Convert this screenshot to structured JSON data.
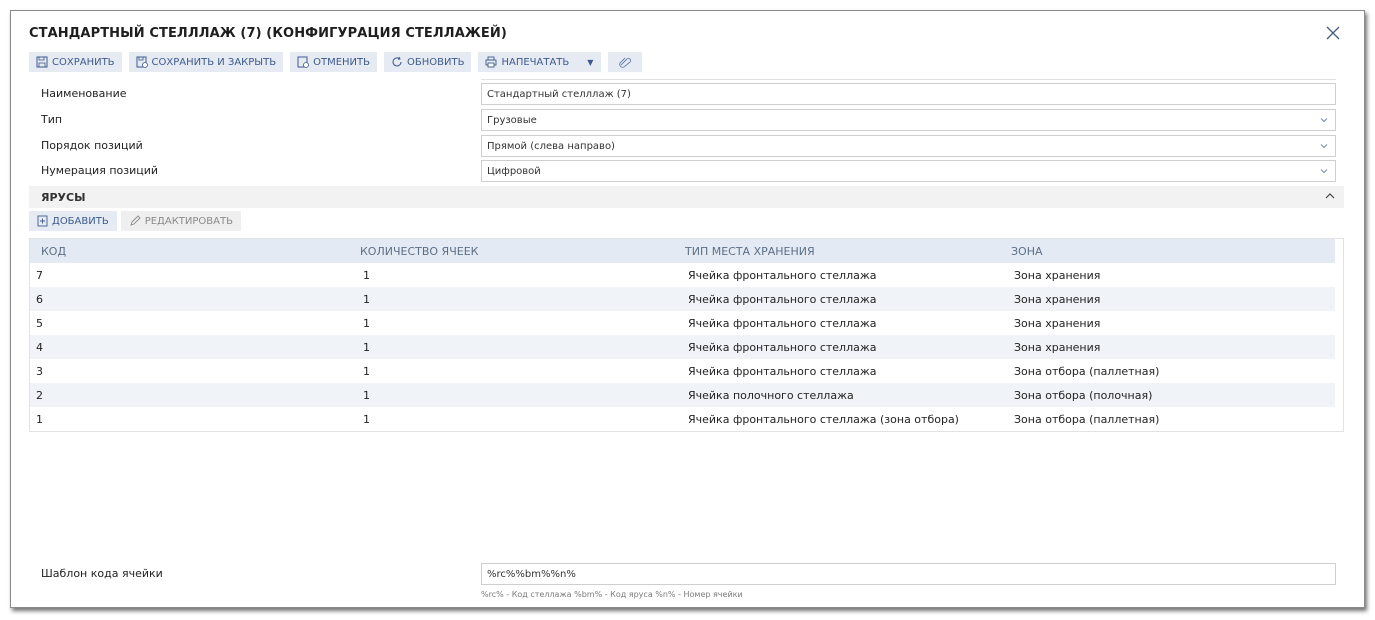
{
  "window": {
    "title": "СТАНДАРТНЫЙ СТЕЛЛЛАЖ (7) (КОНФИГУРАЦИЯ СТЕЛЛАЖЕЙ)"
  },
  "toolbar": {
    "save": "СОХРАНИТЬ",
    "save_close": "СОХРАНИТЬ И ЗАКРЫТЬ",
    "cancel": "ОТМЕНИТЬ",
    "refresh": "ОБНОВИТЬ",
    "print": "НАПЕЧАТАТЬ"
  },
  "fields": [
    {
      "label": "Наименование",
      "value": "Стандартный стелллаж (7)"
    },
    {
      "label": "Тип",
      "value": "Грузовые"
    },
    {
      "label": "Порядок позиций",
      "value": "Прямой (слева направо)"
    },
    {
      "label": "Нумерация позиций",
      "value": "Цифровой"
    }
  ],
  "tiers": {
    "title": "ЯРУСЫ",
    "add": "ДОБАВИТЬ",
    "edit": "РЕДАКТИРОВАТЬ",
    "columns": [
      "КОД",
      "КОЛИЧЕСТВО ЯЧЕЕК",
      "ТИП МЕСТА ХРАНЕНИЯ",
      "ЗОНА"
    ],
    "rows": [
      [
        "7",
        "1",
        "Ячейка фронтального стеллажа",
        "Зона хранения"
      ],
      [
        "6",
        "1",
        "Ячейка фронтального стеллажа",
        "Зона хранения"
      ],
      [
        "5",
        "1",
        "Ячейка фронтального стеллажа",
        "Зона хранения"
      ],
      [
        "4",
        "1",
        "Ячейка фронтального стеллажа",
        "Зона хранения"
      ],
      [
        "3",
        "1",
        "Ячейка фронтального стеллажа",
        "Зона отбора (паллетная)"
      ],
      [
        "2",
        "1",
        "Ячейка полочного стеллажа",
        "Зона отбора (полочная)"
      ],
      [
        "1",
        "1",
        "Ячейка фронтального стеллажа (зона отбора)",
        "Зона отбора (паллетная)"
      ]
    ]
  },
  "template": {
    "label": "Шаблон кода ячейки",
    "value": "%rc%%bm%%n%",
    "hint": "%rc% - Код стеллажа %bm% - Код яруса %n% - Номер ячейки"
  },
  "colors": {
    "accent": "#3d5a8c",
    "button_bg": "#e6ebf3",
    "header_bg": "#e4eaf4",
    "row_alt": "#f0f3f8"
  }
}
